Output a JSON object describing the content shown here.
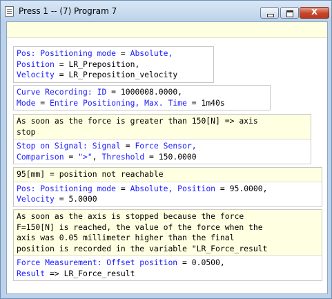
{
  "window": {
    "title": "Press 1 -- (7) Program 7",
    "close_glyph": "x"
  },
  "blocks": {
    "b1": {
      "l1_kw": "Pos: Positioning mode",
      "l1_eq": " = ",
      "l1_val": "Absolute,",
      "l2_kw": "Position",
      "l2_rest": " = LR_Preposition,",
      "l3_kw": "Velocity",
      "l3_rest": " = LR_Preposition_velocity"
    },
    "b2": {
      "l1_kw": "Curve Recording: ID",
      "l1_rest": " = 1000008.0000,",
      "l2_kw": "Mode",
      "l2_eq": " = ",
      "l2_val": "Entire Positioning, Max. Time",
      "l2_rest": " = 1m40s"
    },
    "b3": {
      "comment": "As soon as the force is greater than 150[N] => axis\nstop",
      "l1_kw": "Stop on Signal: Signal",
      "l1_eq": " = ",
      "l1_val": "Force Sensor,",
      "l2_kw": "Comparison",
      "l2_eq": " = ",
      "l2_val": "\">\"",
      "l2_rest": ", ",
      "l2_kw2": "Threshold",
      "l2_rest2": " = 150.0000"
    },
    "b4": {
      "comment": "95[mm] = position not reachable",
      "l1_kw": "Pos: Positioning mode",
      "l1_eq": " = ",
      "l1_val": "Absolute, Position",
      "l1_rest": " = 95.0000,",
      "l2_kw": "Velocity",
      "l2_rest": " = 5.0000"
    },
    "b5": {
      "comment": "As soon as the axis is stopped because the force\nF=150[N] is reached, the value of the force when the\naxis was 0.05 millimeter higher than the final\nposition is recorded in the variable \"LR_Force_result",
      "l1_kw": "Force Measurement: Offset position",
      "l1_rest": " = 0.0500,",
      "l2_kw": "Result",
      "l2_rest": " => LR_Force_result"
    }
  },
  "colors": {
    "keyword": "#1a1aff",
    "comment_bg": "#ffffe1",
    "titlebar": "#bcd2ea"
  }
}
